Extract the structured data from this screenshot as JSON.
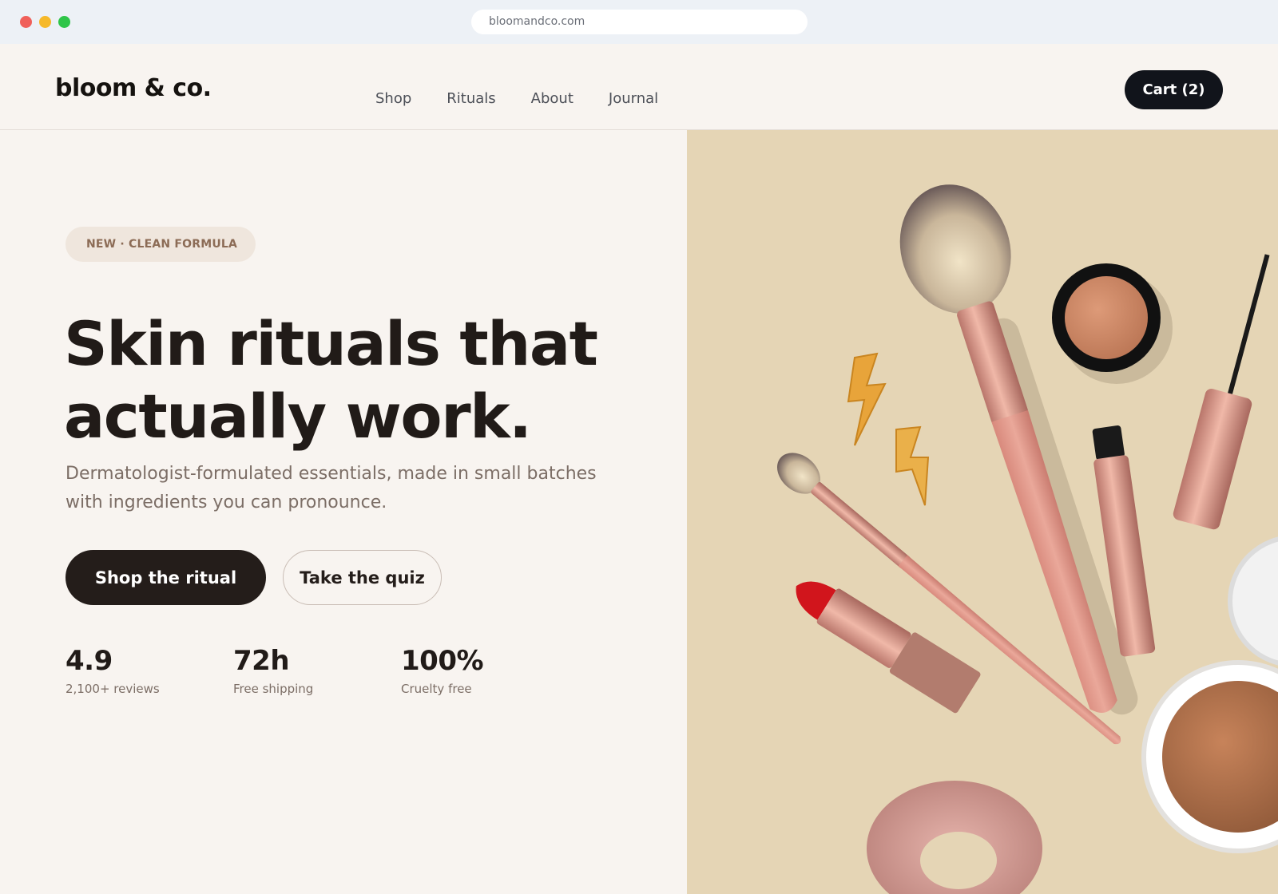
{
  "browser": {
    "url": "bloomandco.com"
  },
  "header": {
    "logo": "bloom & co.",
    "nav": [
      "Shop",
      "Rituals",
      "About",
      "Journal"
    ],
    "cart_label": "Cart (2)"
  },
  "hero": {
    "badge": "NEW · CLEAN FORMULA",
    "headline_line1": "Skin rituals that",
    "headline_line2": "actually work.",
    "subtitle_line1": "Dermatologist-formulated essentials, made in small batches",
    "subtitle_line2": "with ingredients you can pronounce.",
    "primary_cta": "Shop the ritual",
    "secondary_cta": "Take the quiz",
    "stats": [
      {
        "value": "4.9",
        "label": "2,100+ reviews"
      },
      {
        "value": "72h",
        "label": "Free shipping"
      },
      {
        "value": "100%",
        "label": "Cruelty free"
      }
    ]
  },
  "colors": {
    "page_bg": "#f8f4f0",
    "primary_button": "#241d1a",
    "cart_button": "#11141b",
    "badge_bg": "#efe6dd",
    "badge_text": "#8c6c56",
    "image_bg": "#e5d5b5",
    "rose_gold": "#d9958a"
  }
}
